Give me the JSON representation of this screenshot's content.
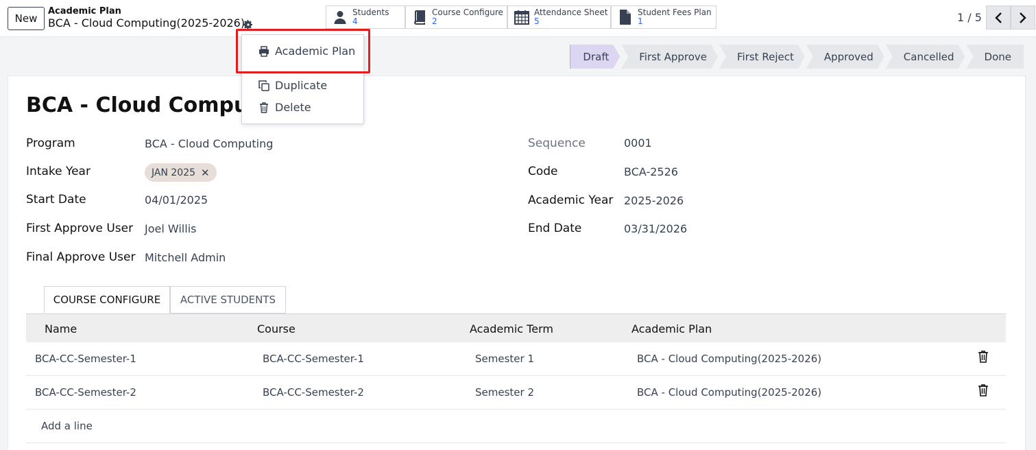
{
  "control_panel": {
    "new_label": "New",
    "breadcrumb_parent": "Academic Plan",
    "breadcrumb_current": "BCA - Cloud Computing(2025-2026)",
    "pager_value": "1 / 5"
  },
  "smart_buttons": [
    {
      "label": "Students",
      "value": "4",
      "icon": "user-icon"
    },
    {
      "label": "Course Configure",
      "value": "2",
      "icon": "book-icon"
    },
    {
      "label": "Attendance Sheet",
      "value": "5",
      "icon": "calendar-icon"
    },
    {
      "label": "Student Fees Plan",
      "value": "1",
      "icon": "file-icon"
    }
  ],
  "action_menu": {
    "items": [
      {
        "label": "Academic Plan",
        "icon": "print-icon"
      },
      {
        "label": "Duplicate",
        "icon": "copy-icon"
      },
      {
        "label": "Delete",
        "icon": "trash-icon"
      }
    ]
  },
  "statusbar": {
    "stages": [
      "Draft",
      "First Approve",
      "First Reject",
      "Approved",
      "Cancelled",
      "Done"
    ],
    "active": "Draft"
  },
  "record": {
    "title": "BCA - Cloud Computing",
    "program_label": "Program",
    "program": "BCA - Cloud Computing",
    "intake_year_label": "Intake Year",
    "intake_year_tag": "JAN 2025",
    "start_date_label": "Start Date",
    "start_date": "04/01/2025",
    "first_approve_user_label": "First Approve User",
    "first_approve_user": "Joel Willis",
    "final_approve_user_label": "Final Approve User",
    "final_approve_user": "Mitchell Admin",
    "sequence_label": "Sequence",
    "sequence": "0001",
    "code_label": "Code",
    "code": "BCA-2526",
    "academic_year_label": "Academic Year",
    "academic_year": "2025-2026",
    "end_date_label": "End Date",
    "end_date": "03/31/2026"
  },
  "tabs": [
    {
      "label": "COURSE CONFIGURE",
      "active": true
    },
    {
      "label": "ACTIVE STUDENTS",
      "active": false
    }
  ],
  "table": {
    "columns": [
      "Name",
      "Course",
      "Academic Term",
      "Academic Plan"
    ],
    "rows": [
      [
        "BCA-CC-Semester-1",
        "BCA-CC-Semester-1",
        "Semester 1",
        "BCA - Cloud Computing(2025-2026)"
      ],
      [
        "BCA-CC-Semester-2",
        "BCA-CC-Semester-2",
        "Semester 2",
        "BCA - Cloud Computing(2025-2026)"
      ]
    ],
    "add_line_label": "Add a line"
  },
  "colors": {
    "highlight": "#e11d1d",
    "active_stage": "#ddd6f3",
    "link": "#2563eb"
  }
}
